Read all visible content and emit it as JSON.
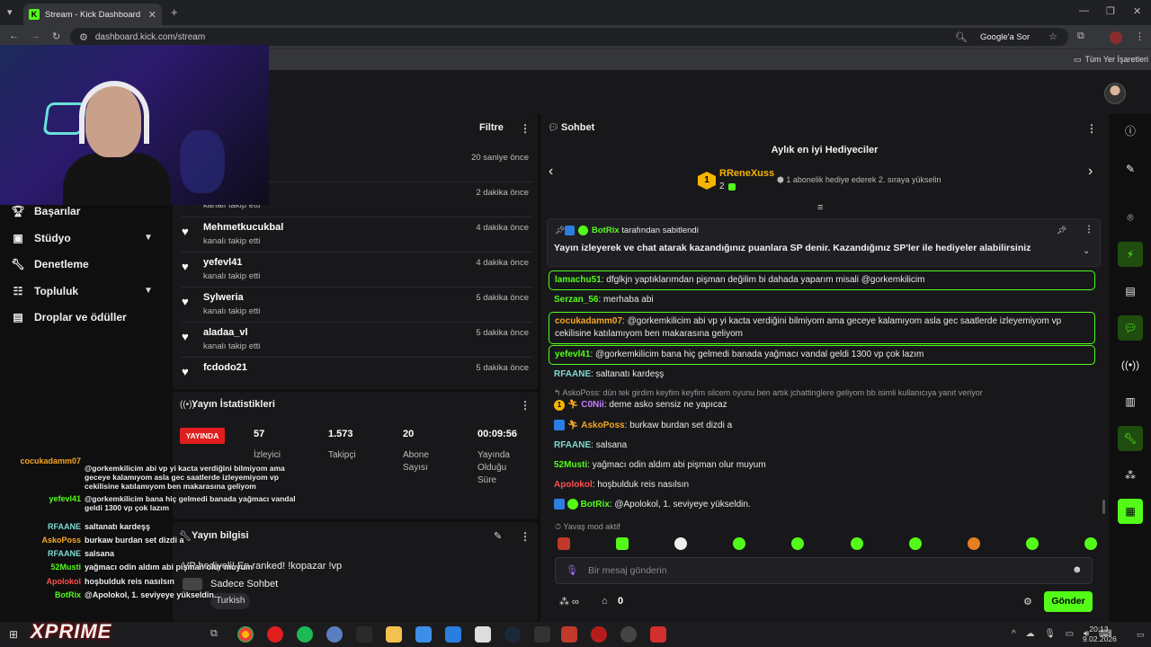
{
  "browser": {
    "tab_title": "Stream - Kick Dashboard",
    "url": "dashboard.kick.com/stream",
    "google_button": "Google'a Sor",
    "bookmarks_label": "Tüm Yer İşaretleri"
  },
  "sidebar": {
    "items": [
      {
        "label": "Başarılar",
        "icon": "trophy-icon"
      },
      {
        "label": "Stüdyo",
        "icon": "studio-icon",
        "expandable": true
      },
      {
        "label": "Denetleme",
        "icon": "wrench-icon"
      },
      {
        "label": "Topluluk",
        "icon": "community-icon",
        "expandable": true
      },
      {
        "label": "Droplar ve ödüller",
        "icon": "gift-icon"
      }
    ]
  },
  "activity": {
    "filter_label": "Filtre",
    "rows": [
      {
        "name": "",
        "sub": "",
        "time": "20 saniye önce"
      },
      {
        "name": "",
        "sub": "kanalı takip etti",
        "time": "2 dakika önce"
      },
      {
        "name": "Mehmetkucukbal",
        "sub": "kanalı takip etti",
        "time": "4 dakika önce"
      },
      {
        "name": "yefevl41",
        "sub": "kanalı takip etti",
        "time": "4 dakika önce"
      },
      {
        "name": "Sylweria",
        "sub": "kanalı takip etti",
        "time": "5 dakika önce"
      },
      {
        "name": "aladaa_vl",
        "sub": "kanalı takip etti",
        "time": "5 dakika önce"
      },
      {
        "name": "fcdodo21",
        "sub": "kanalı takip etti",
        "time": "5 dakika önce"
      }
    ]
  },
  "stats": {
    "title": "Yayın İstatistikleri",
    "live_badge": "YAYINDA",
    "items": [
      {
        "value": "57",
        "label": "İzleyici"
      },
      {
        "value": "1.573",
        "label": "Takipçi"
      },
      {
        "value": "20",
        "label": "Abone Sayısı"
      },
      {
        "value": "00:09:56",
        "label": "Yayında Olduğu Süre"
      }
    ]
  },
  "stream_info": {
    "title": "Yayın bilgisi",
    "stream_title": "VP hediyeli! En ranked! !kopazar !vp",
    "mode": "Sadece Sohbet",
    "language": "Turkish"
  },
  "overlay_chat": [
    {
      "name": "cocukadamm07",
      "msg": "@gorkemkilicim abi vp yi kacta verdiğini bilmiyom ama geceye kalamıyom asla gec saatlerde izleyemiyom vp cekilisine katılamıyom ben makarasına geliyom",
      "color": "#f5a623"
    },
    {
      "name": "yefevl41",
      "msg": "@gorkemkilicim bana hiç gelmedi banada yağmacı vandal geldi 1300 vp çok lazım",
      "color": "#53fc18"
    },
    {
      "name": "RFAANE",
      "msg": "saltanatı kardeşş",
      "color": "#7fd8d0"
    },
    {
      "name": "AskoPoss",
      "msg": "burkaw burdan set dizdi a",
      "color": "#f5a623"
    },
    {
      "name": "RFAANE",
      "msg": "salsana",
      "color": "#7fd8d0"
    },
    {
      "name": "52Musti",
      "msg": "yağmacı odin aldım abi pişman olur muyum",
      "color": "#53fc18"
    },
    {
      "name": "Apolokol",
      "msg": "hoşbulduk reis nasılsın",
      "color": "#ff4d4d"
    },
    {
      "name": "BotRix",
      "msg": "@Apolokol, 1. seviyeye yükseldin.",
      "color": "#53fc18"
    }
  ],
  "chat": {
    "title": "Sohbet",
    "gifters_title": "Aylık en iyi Hediyeciler",
    "top_gifter": {
      "rank": "1",
      "name": "RReneXuss",
      "count": "2"
    },
    "gifter_hint": "1 abonelik hediye ederek 2. sıraya yükselin",
    "pinned_by": "BotRix",
    "pinned_suffix": "tarafından sabitlendi",
    "pinned_text": "Yayın izleyerek ve chat atarak kazandığınız puanlara SP denir. Kazandığınız SP'ler ile hediyeler alabilirsiniz",
    "messages": [
      {
        "user": "lamachu51",
        "text": "dfglkjn yaptıklarımdan pişman değilim bi dahada yaparım misali @gorkemkilicim",
        "color": "#53fc18",
        "highlight": true
      },
      {
        "user": "Serzan_56",
        "text": "merhaba abi",
        "color": "#53fc18",
        "highlight": false
      },
      {
        "user": "cocukadamm07",
        "text": "@gorkemkilicim abi vp yi kacta verdiğini bilmiyom ama geceye kalamıyom asla gec saatlerde izleyemiyom vp cekilisine katılamıyom ben makarasına geliyom",
        "color": "#f5a623",
        "highlight": true
      },
      {
        "user": "yefevl41",
        "text": "@gorkemkilicim bana hiç gelmedi banada yağmacı vandal geldi 1300 vp çok lazım",
        "color": "#53fc18",
        "highlight": true
      },
      {
        "user": "RFAANE",
        "text": "saltanatı kardeşş",
        "color": "#7fd8d0",
        "highlight": false
      },
      {
        "user": "C0Nii",
        "text": "deme asko sensiz ne yapıcaz",
        "color": "#c77dff",
        "highlight": false,
        "reply": "AskoPoss: dün tek girdim keyfim keyfim silcem oyunu ben artık jchattinglere geliyom bb isimli kullanıcıya yanıt veriyor"
      },
      {
        "user": "AskoPoss",
        "text": "burkaw burdan set dizdi a",
        "color": "#f5a623",
        "highlight": false
      },
      {
        "user": "RFAANE",
        "text": "salsana",
        "color": "#7fd8d0",
        "highlight": false
      },
      {
        "user": "52Musti",
        "text": "yağmacı odin aldım abi pişman olur muyum",
        "color": "#53fc18",
        "highlight": false
      },
      {
        "user": "Apolokol",
        "text": "hoşbulduk reis nasılsın",
        "color": "#ff4d4d",
        "highlight": false
      },
      {
        "user": "BotRix",
        "text": "@Apolokol, 1. seviyeye yükseldin.",
        "color": "#53fc18",
        "highlight": false
      }
    ],
    "slow_mode": "Yavaş mod aktif",
    "input_placeholder": "Bir mesaj gönderin",
    "points": "0",
    "send_label": "Gönder"
  },
  "taskbar": {
    "time": "20:13",
    "date": "9.02.2026",
    "brand": "XPRIME"
  },
  "colors": {
    "accent": "#53fc18",
    "live": "#e01e1e",
    "panel": "#18181b",
    "background": "#0f0f10"
  }
}
